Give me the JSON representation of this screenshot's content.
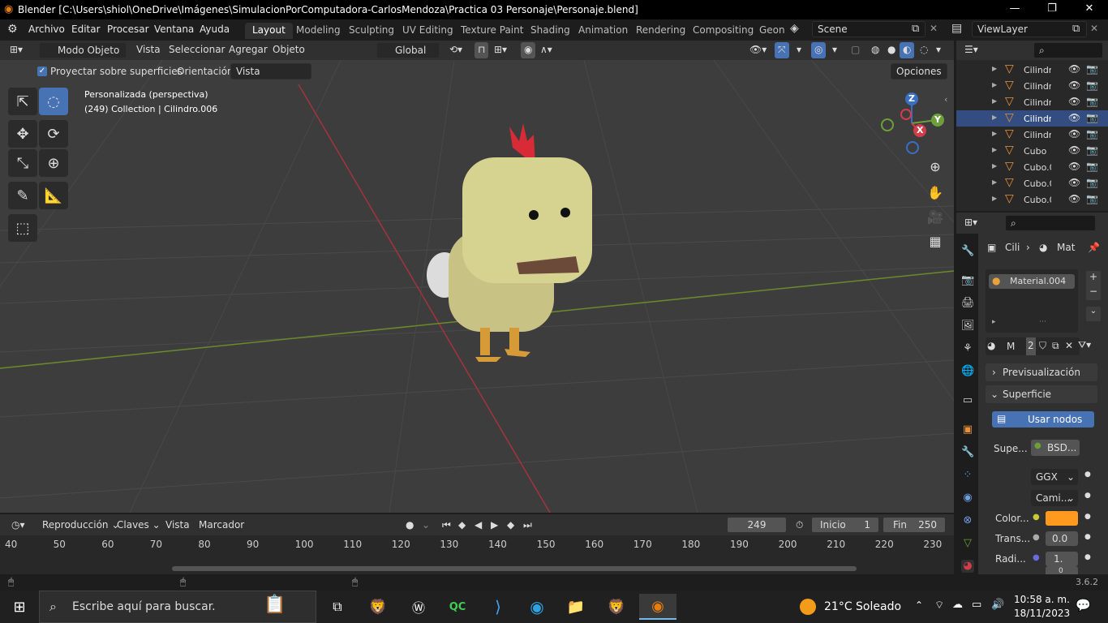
{
  "window": {
    "title": "Blender [C:\\Users\\shiol\\OneDrive\\Imágenes\\SimulacionPorComputadora-CarlosMendoza\\Practica 03 Personaje\\Personaje.blend]",
    "minimize": "—",
    "maximize": "❐",
    "close": "✕"
  },
  "menu": [
    "Archivo",
    "Editar",
    "Procesar",
    "Ventana",
    "Ayuda"
  ],
  "workspaces": [
    "Layout",
    "Modeling",
    "Sculpting",
    "UV Editing",
    "Texture Paint",
    "Shading",
    "Animation",
    "Rendering",
    "Compositing",
    "Geon"
  ],
  "scene": {
    "name": "Scene",
    "view_layer": "ViewLayer"
  },
  "viewport_header": {
    "mode": "Modo Objeto",
    "menus": [
      "Vista",
      "Seleccionar",
      "Agregar",
      "Objeto"
    ],
    "orientation": "Global"
  },
  "tool_settings": {
    "project_label": "Proyectar sobre superficies",
    "orientation_label": "Orientación:",
    "orientation_value": "Vista",
    "options": "Opciones"
  },
  "viewport_info": {
    "line1": "Personalizada (perspectiva)",
    "line2": "(249) Collection | Cilindro.006"
  },
  "gizmo": {
    "z": "Z",
    "y": "Y",
    "x": "X"
  },
  "outliner": {
    "items": [
      {
        "name": "Cilindr",
        "selected": false
      },
      {
        "name": "Cilindr",
        "selected": false
      },
      {
        "name": "Cilindr",
        "selected": false
      },
      {
        "name": "Cilindr",
        "selected": true
      },
      {
        "name": "Cilindr",
        "selected": false
      },
      {
        "name": "Cubo",
        "selected": false
      },
      {
        "name": "Cubo.0",
        "selected": false
      },
      {
        "name": "Cubo.0",
        "selected": false
      },
      {
        "name": "Cubo.0",
        "selected": false
      }
    ]
  },
  "properties": {
    "breadcrumb_obj": "Cili",
    "breadcrumb_mat": "Mat",
    "material_slot": "Material.004",
    "mat_name": "M",
    "mat_users": "2",
    "preview_label": "Previsualización",
    "surface_label": "Superficie",
    "use_nodes": "Usar nodos",
    "surface_field": "Supe...",
    "bsdf": "BSD...",
    "distribution": "GGX",
    "subsurface": "Cami...",
    "color_label": "Color...",
    "color_value": "#ff9a1f",
    "trans_label": "Trans...",
    "trans_value": "0.0",
    "radius_label": "Radi...",
    "radius_value": "1.",
    "radius_value2": "0"
  },
  "timeline": {
    "menus": [
      "Reproducción",
      "Claves",
      "Vista",
      "Marcador"
    ],
    "current_frame": "249",
    "start_label": "Inicio",
    "start": "1",
    "end_label": "Fin",
    "end": "250",
    "ticks": [
      "40",
      "50",
      "60",
      "70",
      "80",
      "90",
      "100",
      "110",
      "120",
      "130",
      "140",
      "150",
      "160",
      "170",
      "180",
      "190",
      "200",
      "210",
      "220",
      "230"
    ]
  },
  "status": {
    "version": "3.6.2"
  },
  "taskbar": {
    "search_placeholder": "Escribe aquí para buscar.",
    "weather": "21°C  Soleado",
    "time": "10:58 a. m.",
    "date": "18/11/2023"
  },
  "colors": {
    "accent": "#4772b3",
    "selected_row": "#334d80",
    "object_orange": "#e8913c"
  }
}
